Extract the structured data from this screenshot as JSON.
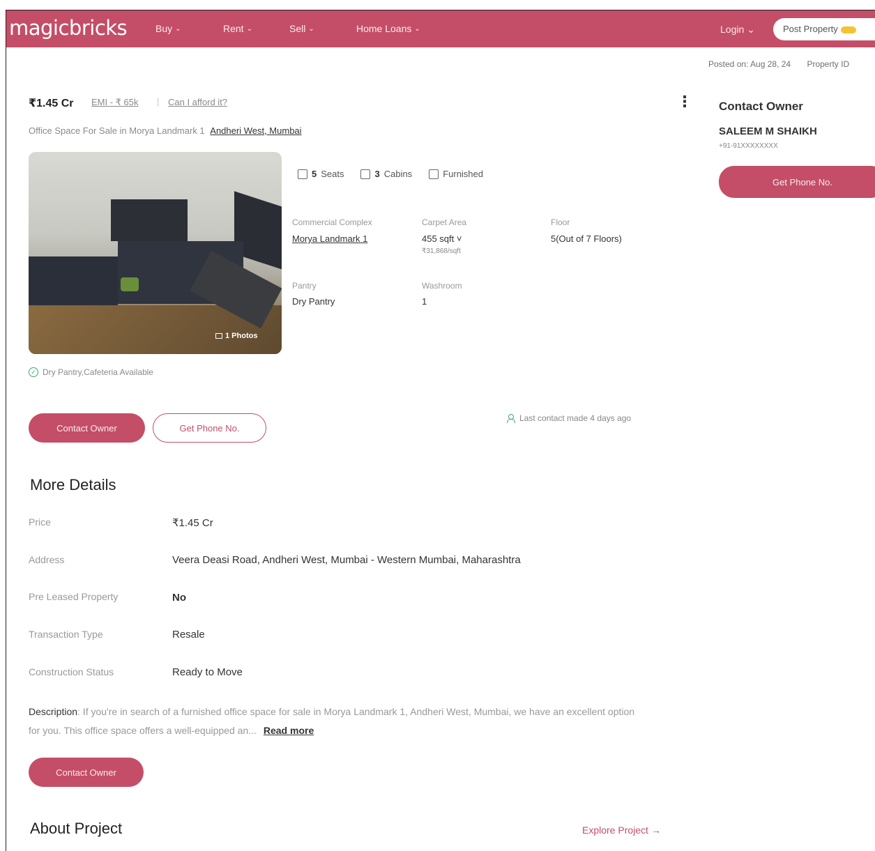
{
  "header": {
    "logo": "magicbricks",
    "nav": [
      {
        "label": "Buy"
      },
      {
        "label": "Rent"
      },
      {
        "label": "Sell"
      },
      {
        "label": "Home Loans"
      }
    ],
    "login": "Login",
    "post_property": "Post Property",
    "brand_color": "#c44e67"
  },
  "meta": {
    "posted_on": "Posted on: Aug 28, 24",
    "property_id": "Property ID"
  },
  "listing": {
    "price": "₹1.45 Cr",
    "emi": "EMI - ₹ 65k",
    "afford": "Can I afford it?",
    "title": "Office Space For Sale in Morya Landmark 1",
    "location": "Andheri West, Mumbai",
    "photos_count": "1 Photos",
    "amenity": "Dry Pantry,Cafeteria Available",
    "features": {
      "seats_value": "5",
      "seats_label": "Seats",
      "cabins_value": "3",
      "cabins_label": "Cabins",
      "furnishing": "Furnished"
    },
    "summary": {
      "complex_label": "Commercial Complex",
      "complex_value": "Morya Landmark 1",
      "carpet_label": "Carpet Area",
      "carpet_value": "455 sqft",
      "carpet_sub": "₹31,868/sqft",
      "floor_label": "Floor",
      "floor_value": "5(Out of 7 Floors)",
      "pantry_label": "Pantry",
      "pantry_value": "Dry Pantry",
      "washroom_label": "Washroom",
      "washroom_value": "1"
    },
    "contact_owner_btn": "Contact Owner",
    "get_phone_btn": "Get Phone No.",
    "last_contact": "Last contact made 4 days ago"
  },
  "owner_card": {
    "title": "Contact Owner",
    "name": "SALEEM M SHAIKH",
    "phone": "+91-91XXXXXXXX",
    "button": "Get Phone No."
  },
  "more_details": {
    "title": "More Details",
    "rows": [
      {
        "label": "Price",
        "value": "₹1.45 Cr"
      },
      {
        "label": "Address",
        "value": "Veera Deasi Road, Andheri West, Mumbai - Western Mumbai, Maharashtra"
      },
      {
        "label": "Pre Leased Property",
        "value": "No"
      },
      {
        "label": "Transaction Type",
        "value": "Resale"
      },
      {
        "label": "Construction Status",
        "value": "Ready to Move"
      }
    ],
    "description_label": "Description",
    "description_text": ": If you're in search of a furnished office space for sale in Morya Landmark 1, Andheri West, Mumbai, we have an excellent option for you. This office space offers a well-equipped an...",
    "read_more": "Read more",
    "contact_owner_btn": "Contact Owner"
  },
  "about_project": {
    "title": "About Project",
    "explore": "Explore Project →"
  }
}
